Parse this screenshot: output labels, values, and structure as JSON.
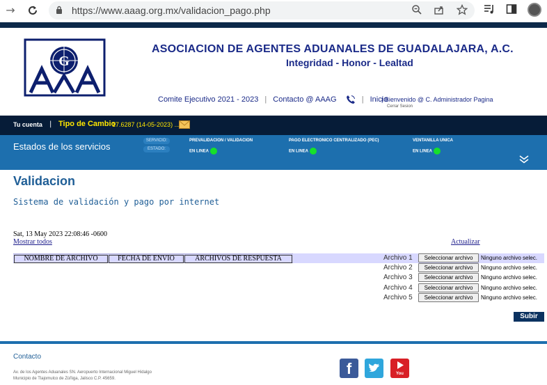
{
  "browser": {
    "url": "https://www.aaag.org.mx/validacion_pago.php"
  },
  "header": {
    "org_title": "ASOCIACION DE AGENTES ADUANALES DE GUADALAJARA, A.C.",
    "motto": "Integridad - Honor - Lealtad",
    "links": {
      "comite": "Comite Ejecutivo 2021 - 2023",
      "contacto": "Contacto @ AAAG",
      "inicio": "Inicio"
    },
    "welcome": "| Bienvenido @ C. Administrador Pagina",
    "logout": "Cerrar Sesion"
  },
  "account_bar": {
    "label": "Tu cuenta",
    "separator": "|",
    "fx_label": "Tipo de Cambio",
    "fx_value": "17.6287 (14-05-2023) ..."
  },
  "services": {
    "title": "Estados de los servicios",
    "tag_service": "SERVICIO:",
    "tag_status": "ESTADO:",
    "items": [
      {
        "name": "PREVALIDACION / VALIDACION",
        "status": "EN LINEA"
      },
      {
        "name": "PAGO ELECTRONICO CENTRALIZADO (PEC)",
        "status": "EN LINEA"
      },
      {
        "name": "VENTANILLA UNICA",
        "status": "EN LINEA"
      }
    ],
    "status_color": "#16e02a"
  },
  "main": {
    "title": "Validacion",
    "subtitle": "Sistema de validación y pago por internet",
    "datetime": "Sat, 13 May 2023 22:08:46 -0600",
    "show_all": "Mostrar todos",
    "refresh": "Actualizar",
    "table_headers": [
      "NOMBRE DE ARCHIVO",
      "FECHA DE ENVIO",
      "ARCHIVOS DE RESPUESTA"
    ],
    "files": [
      {
        "label": "Archivo 1",
        "button": "Seleccionar archivo",
        "status": "Ninguno archivo selec."
      },
      {
        "label": "Archivo 2",
        "button": "Seleccionar archivo",
        "status": "Ninguno archivo selec."
      },
      {
        "label": "Archivo 3",
        "button": "Seleccionar archivo",
        "status": "Ninguno archivo selec."
      },
      {
        "label": "Archivo 4",
        "button": "Seleccionar archivo",
        "status": "Ninguno archivo selec."
      },
      {
        "label": "Archivo 5",
        "button": "Seleccionar archivo",
        "status": "Ninguno archivo selec."
      }
    ],
    "submit": "Subir"
  },
  "footer": {
    "title": "Contacto",
    "address_line1": "Av. de los Agentes Aduanales SN. Aeropuerto Internacional Miguel Hidalgo",
    "address_line2": "Municipio de Tlajomulco de Zúñiga, Jalisco C.P. 45659.",
    "social": {
      "facebook_glyph": "f",
      "youtube_glyph": "You"
    }
  },
  "colors": {
    "brand_navy": "#1a2a88",
    "bar_dark": "#061c38",
    "bar_blue": "#1d6fae",
    "fx_yellow": "#ffe600",
    "title_blue": "#1f5e96"
  }
}
